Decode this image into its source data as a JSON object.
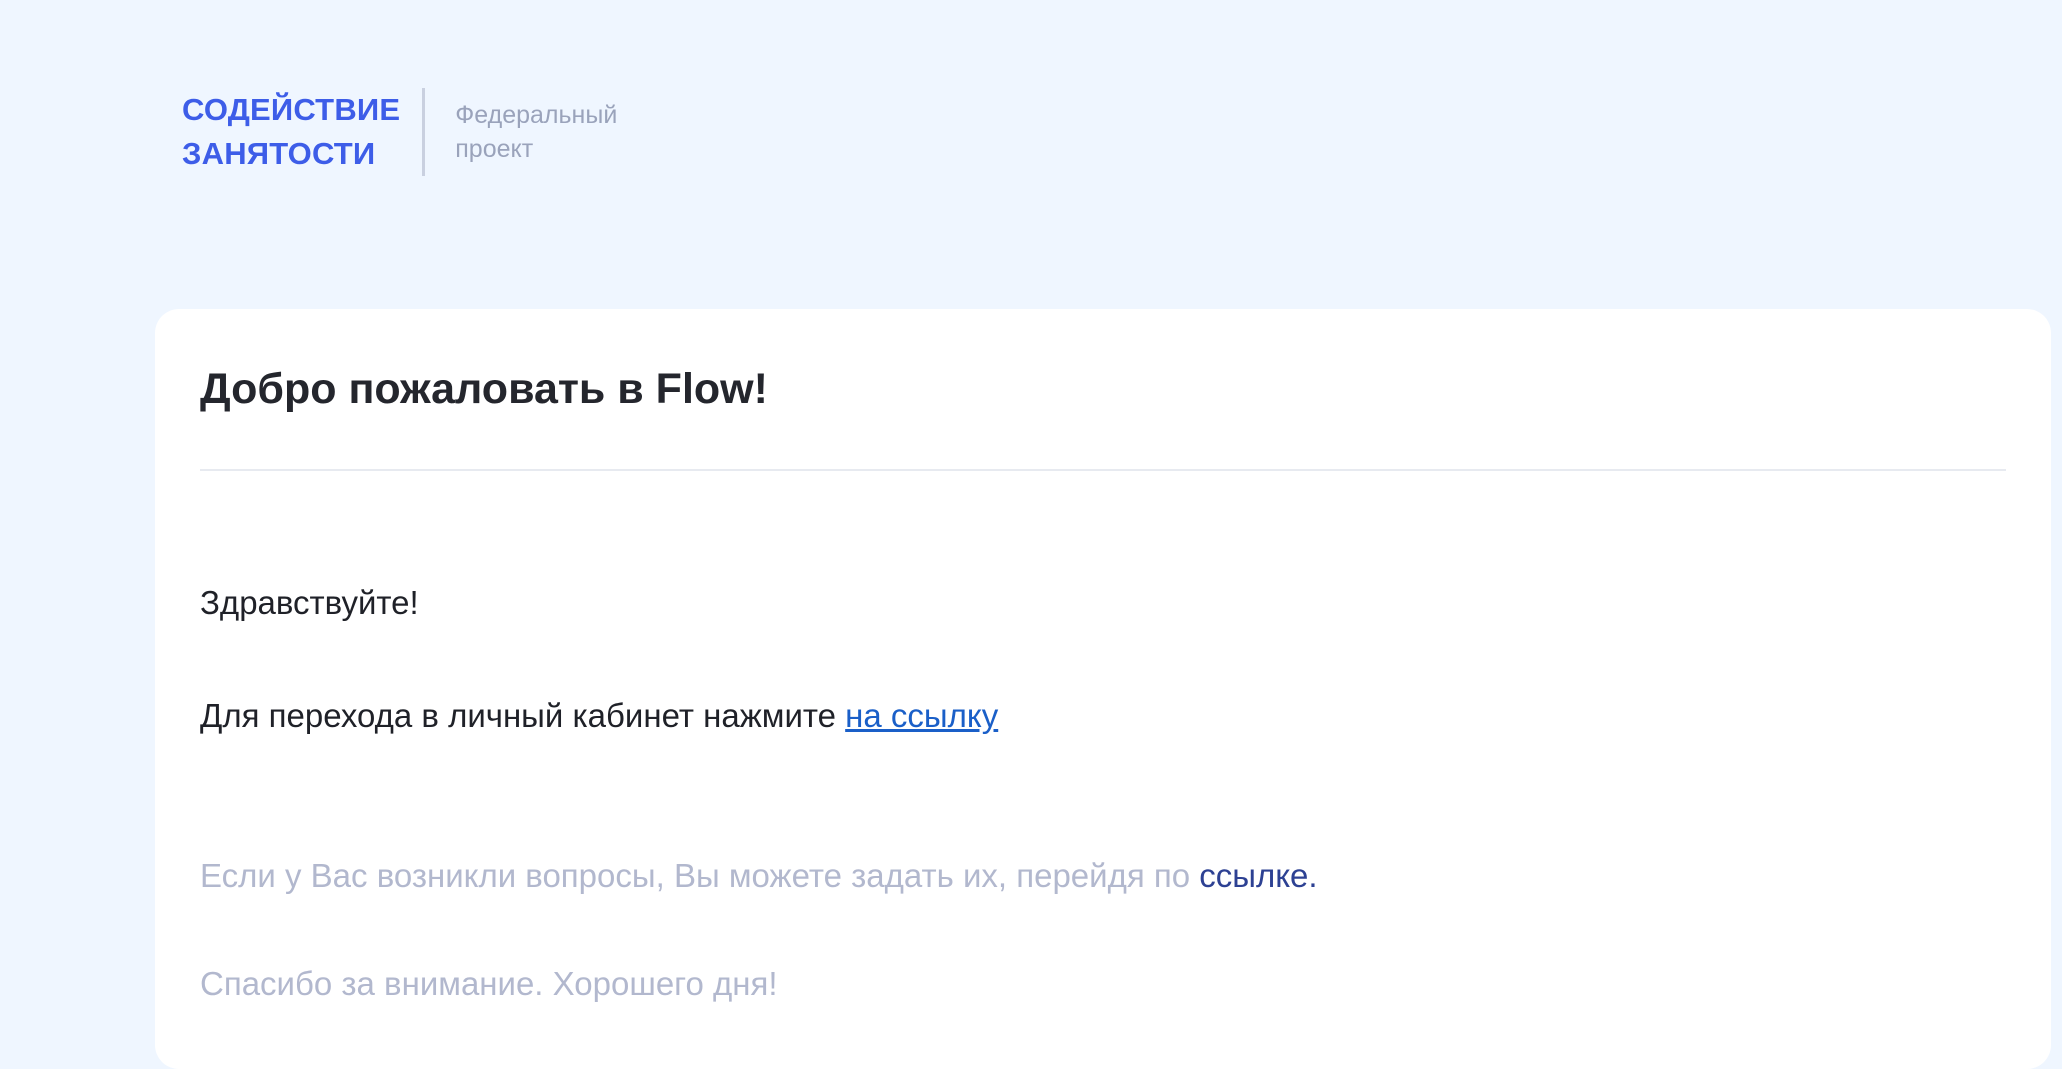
{
  "header": {
    "logo_line1": "СОДЕЙСТВИЕ",
    "logo_line2": "ЗАНЯТОСТИ",
    "subtitle_line1": "Федеральный",
    "subtitle_line2": "проект"
  },
  "email": {
    "title": "Добро пожаловать в Flow!",
    "greeting": "Здравствуйте!",
    "cta_text": "Для перехода в личный кабинет нажмите ",
    "cta_link": "на ссылку",
    "questions_text": "Если у Вас возникли вопросы, Вы можете задать их, перейдя по ",
    "questions_link": "ссылке.",
    "closing": "Спасибо за внимание. Хорошего дня!"
  },
  "colors": {
    "background": "#eff6ff",
    "brand": "#3d5de8",
    "link": "#1a5fc8",
    "secondary_link": "#2d4193",
    "muted_text": "#b2b8ce"
  }
}
